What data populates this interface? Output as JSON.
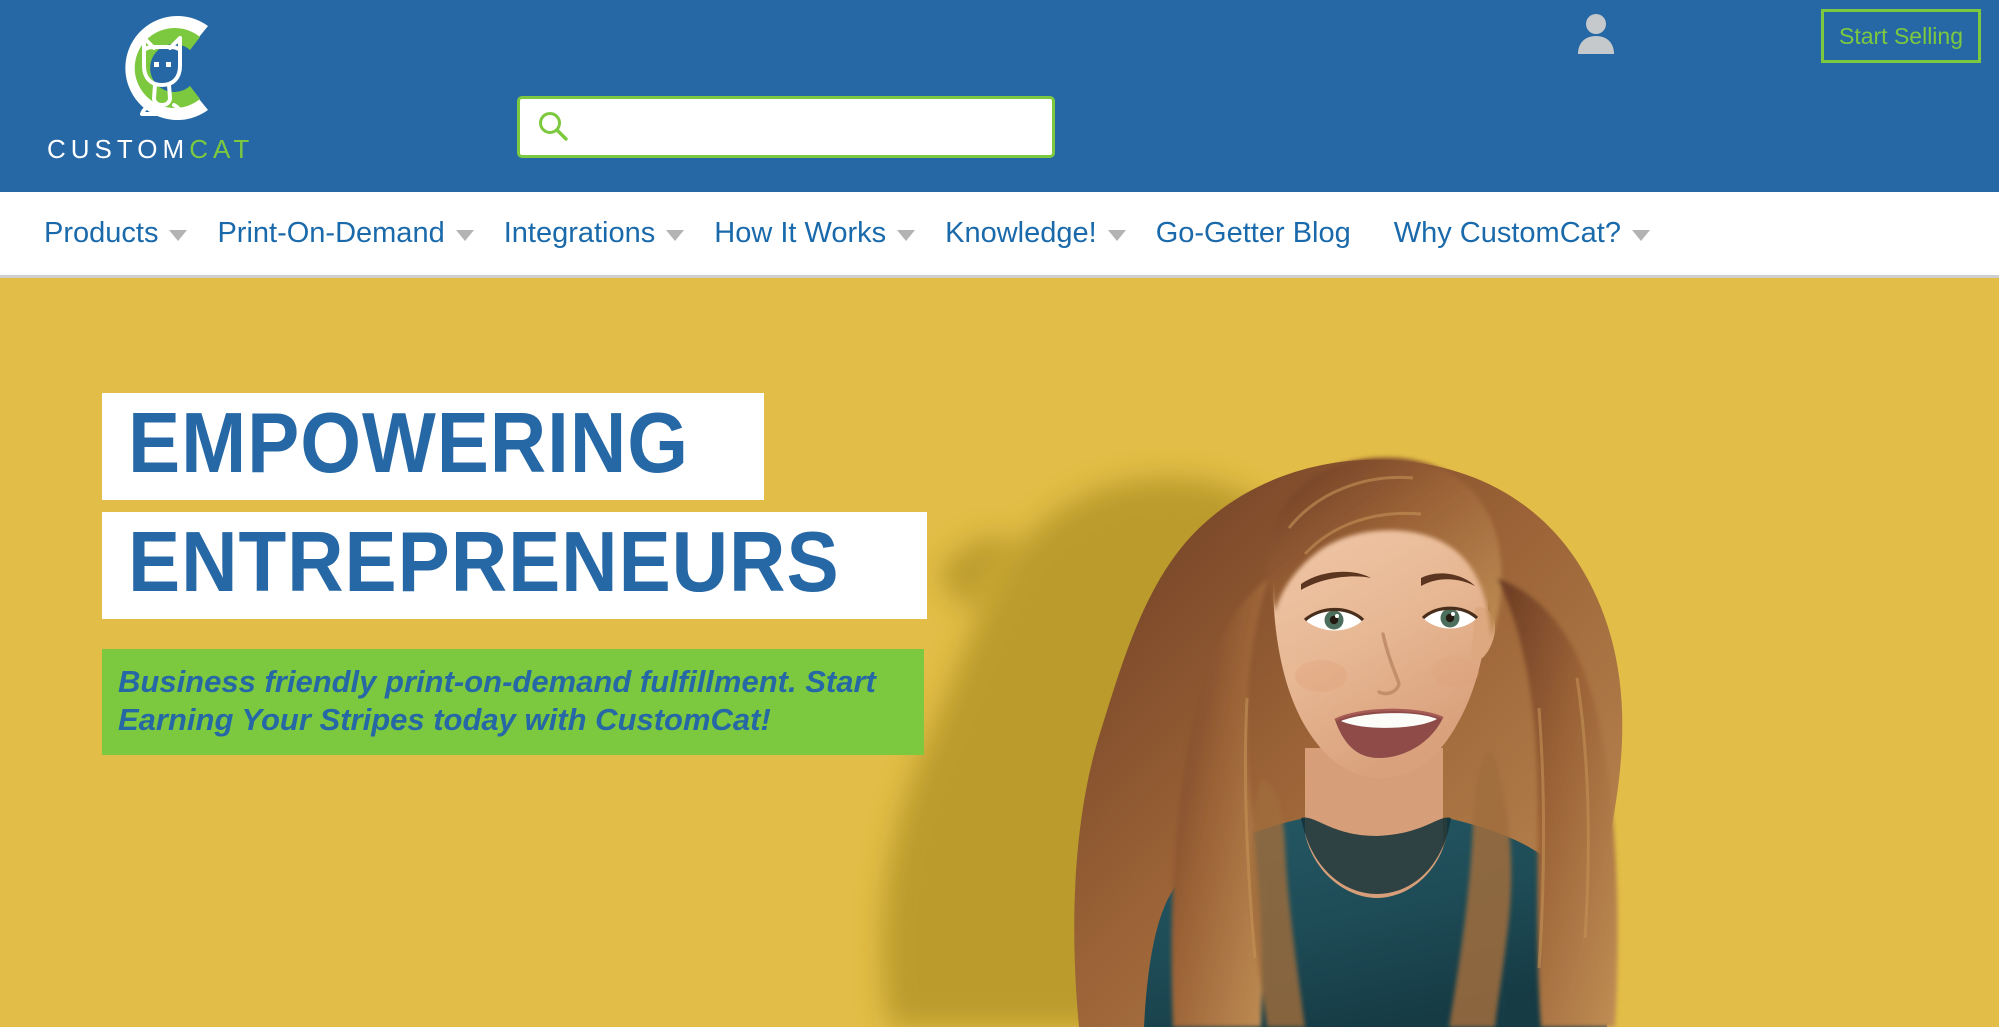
{
  "colors": {
    "header_blue": "#2668a5",
    "accent_green": "#7cc93f",
    "hero_gold": "#e2bd47",
    "nav_link_blue": "#1a6aab",
    "shirt_teal": "#1e4c57"
  },
  "header": {
    "logo": {
      "icon_name": "customcat-cat-logo",
      "wordmark_part1": "CUSTOM",
      "wordmark_part2": "CAT"
    },
    "search": {
      "value": "",
      "placeholder": "",
      "icon": "search-icon"
    },
    "account_icon": "user-account-icon",
    "start_selling_label": "Start Selling"
  },
  "nav": {
    "items": [
      {
        "label": "Products",
        "has_dropdown": true
      },
      {
        "label": "Print-On-Demand",
        "has_dropdown": true
      },
      {
        "label": "Integrations",
        "has_dropdown": true
      },
      {
        "label": "How It Works",
        "has_dropdown": true
      },
      {
        "label": "Knowledge!",
        "has_dropdown": true
      },
      {
        "label": "Go-Getter Blog",
        "has_dropdown": false
      },
      {
        "label": "Why CustomCat?",
        "has_dropdown": true
      }
    ]
  },
  "hero": {
    "headline_line1": "EMPOWERING",
    "headline_line2": "ENTREPRENEURS",
    "subhead": "Business friendly print-on-demand fulfillment. Start Earning Your Stripes today with CustomCat!",
    "photo_alt": "Smiling woman with long wavy auburn hair wearing a dark teal t-shirt against a gold wall with her shadow"
  }
}
